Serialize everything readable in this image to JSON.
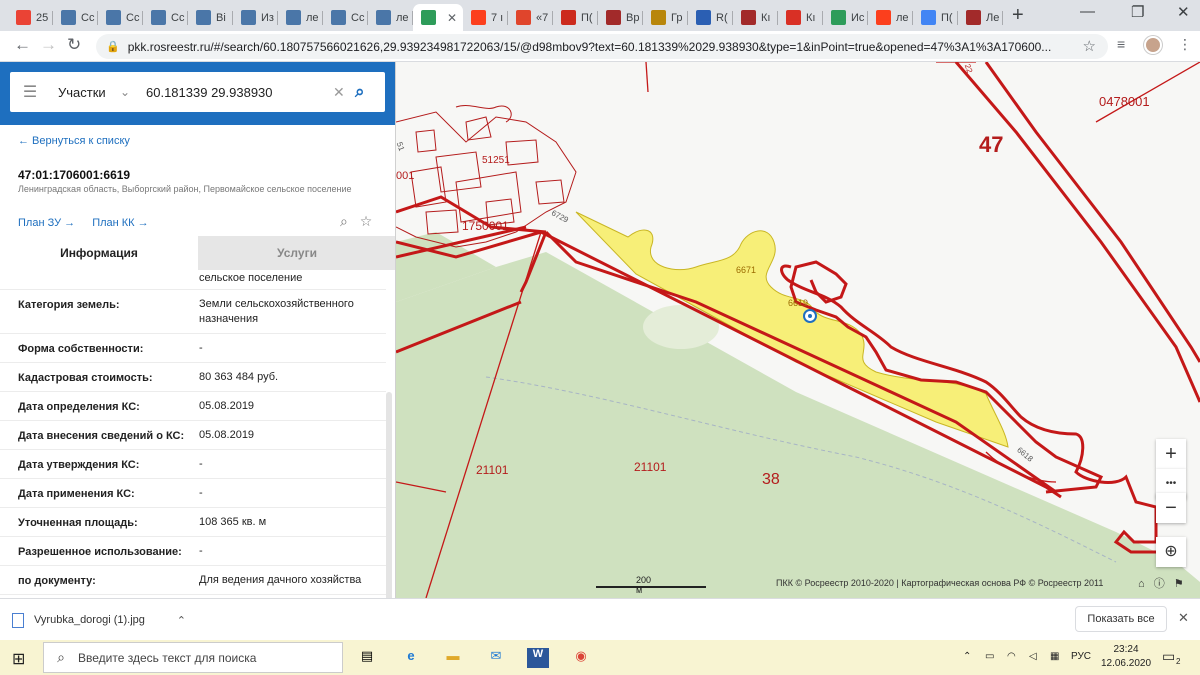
{
  "browser": {
    "tabs": [
      {
        "label": "25",
        "color": "#ea4335"
      },
      {
        "label": "Сс",
        "color": "#4a76a8"
      },
      {
        "label": "Сс",
        "color": "#4a76a8"
      },
      {
        "label": "Сс",
        "color": "#4a76a8"
      },
      {
        "label": "Ві",
        "color": "#4a76a8"
      },
      {
        "label": "Из",
        "color": "#4a76a8"
      },
      {
        "label": "ле",
        "color": "#4a76a8"
      },
      {
        "label": "Сс",
        "color": "#4a76a8"
      },
      {
        "label": "ле",
        "color": "#4a76a8"
      },
      {
        "label": "",
        "color": "#2e9c5a",
        "active": true
      },
      {
        "label": "7 ı",
        "color": "#fc3f1d"
      },
      {
        "label": "«7",
        "color": "#e0452c"
      },
      {
        "label": "П(",
        "color": "#cc2a1d"
      },
      {
        "label": "Вр",
        "color": "#a22a2a"
      },
      {
        "label": "Гр",
        "color": "#b8860b"
      },
      {
        "label": "R(",
        "color": "#2b5fb3"
      },
      {
        "label": "Кı",
        "color": "#a22a2a"
      },
      {
        "label": "Кı",
        "color": "#d93025"
      },
      {
        "label": "Ис",
        "color": "#2e9c5a"
      },
      {
        "label": "ле",
        "color": "#fc3f1d"
      },
      {
        "label": "П(",
        "color": "#4285f4"
      },
      {
        "label": "Ле",
        "color": "#a22a2a"
      }
    ],
    "url": "pkk.rosreestr.ru/#/search/60.180757566021626,29.939234981722063/15/@d98mbov9?text=60.181339%2029.938930&type=1&inPoint=true&opened=47%3A1%3A170600..."
  },
  "search": {
    "type_label": "Участки",
    "query": "60.181339 29.938930"
  },
  "card": {
    "back_link": "← Вернуться к списку",
    "cadastral_number": "47:01:1706001:6619",
    "address": "Ленинградская область, Выборгский район, Первомайское сельское поселение",
    "plan_zu": "План ЗУ →",
    "plan_kk": "План КК →",
    "tab_info": "Информация",
    "tab_services": "Услуги",
    "rows": [
      {
        "key": "",
        "value": "сельское поселение"
      },
      {
        "key": "Категория земель:",
        "value": "Земли сельскохозяйственного назначения"
      },
      {
        "key": "Форма собственности:",
        "value": "-"
      },
      {
        "key": "Кадастровая стоимость:",
        "value": "80 363 484 руб."
      },
      {
        "key": "Дата определения КС:",
        "value": "05.08.2019"
      },
      {
        "key": "Дата внесения сведений о КС:",
        "value": "05.08.2019"
      },
      {
        "key": "Дата утверждения КС:",
        "value": "-"
      },
      {
        "key": "Дата применения КС:",
        "value": "-"
      },
      {
        "key": "Уточненная площадь:",
        "value": "108 365 кв. м"
      },
      {
        "key": "Разрешенное использование:",
        "value": "-"
      },
      {
        "key": "по документу:",
        "value": "Для ведения дачного хозяйства"
      }
    ]
  },
  "map": {
    "labels": {
      "q0478001": "0478001",
      "n47": "47",
      "n51251": "51251",
      "n1750001": "1750001",
      "n6729": "6729",
      "n6671": "6671",
      "n6619": "6619",
      "n6618": "6618",
      "n21101a": "21101",
      "n21101b": "21101",
      "n38": "38",
      "n001": "001",
      "n22": "22",
      "n51": "51"
    },
    "scale_label": "200 м",
    "attribution": "ПКК © Росреестр 2010-2020 | Картографическая основа РФ © Росреестр 2011",
    "controls": {
      "zoom_in": "+",
      "more": "•••",
      "zoom_out": "−"
    }
  },
  "downloads": {
    "file_name": "Vyrubka_dorogi (1).jpg",
    "show_all": "Показать все"
  },
  "taskbar": {
    "search_placeholder": "Введите здесь текст для поиска",
    "lang": "РУС",
    "time": "23:24",
    "date": "12.06.2020",
    "notif_count": "2"
  }
}
